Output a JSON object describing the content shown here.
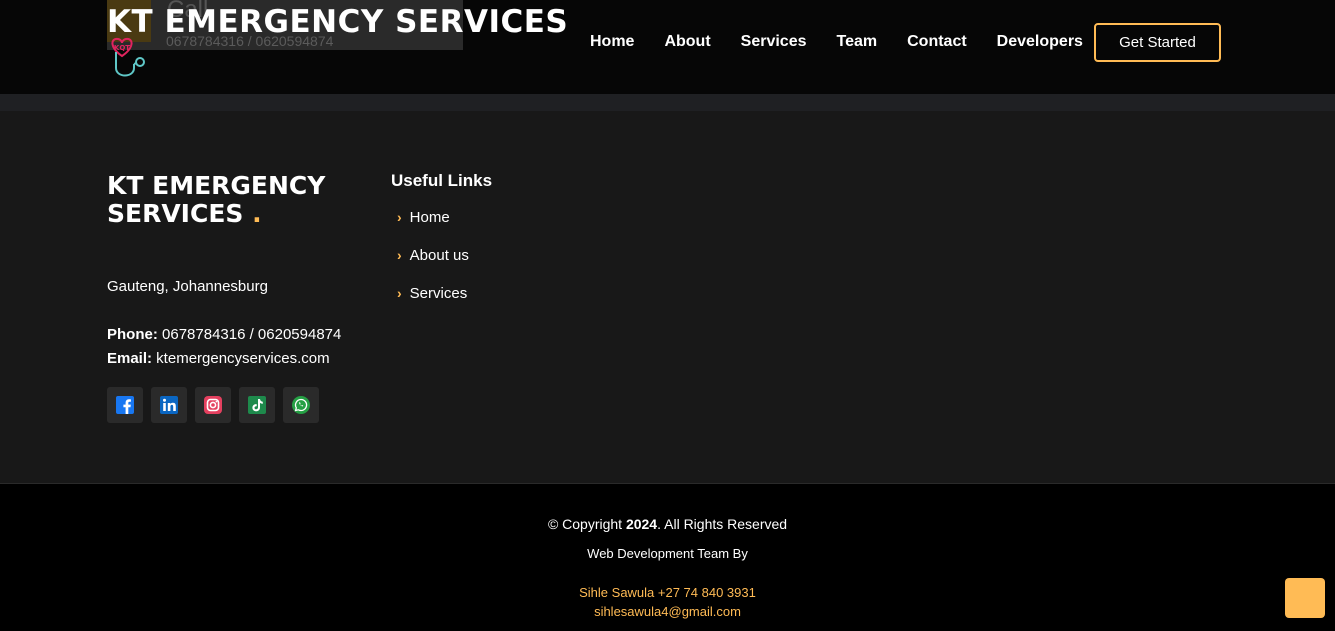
{
  "header": {
    "ghost_call_label": "Call",
    "ghost_call_phone": "0678784316 / 0620594874",
    "brand": "KT EMERGENCY SERVICES",
    "nav": [
      "Home",
      "About",
      "Services",
      "Team",
      "Contact",
      "Developers"
    ],
    "cta": "Get Started"
  },
  "footer": {
    "brand": "KT EMERGENCY SERVICES",
    "brand_dot": ".",
    "address": "Gauteng, Johannesburg",
    "phone_label": "Phone:",
    "phone": " 0678784316 / 0620594874",
    "email_label": "Email:",
    "email": " ktemergencyservices.com",
    "socials": [
      "facebook",
      "linkedin",
      "instagram",
      "tiktok",
      "whatsapp"
    ],
    "useful_links_title": "Useful Links",
    "useful_links": [
      "Home",
      "About us",
      "Services"
    ]
  },
  "bottom": {
    "copyright_prefix": "© Copyright ",
    "copyright_year": "2024",
    "copyright_suffix": ". All Rights Reserved",
    "web_dev": "Web Development Team By",
    "dev_name": "Sihle Sawula +27 74 840 3931",
    "dev_email": "sihlesawula4@gmail.com"
  },
  "colors": {
    "accent": "#ffbb55",
    "header_bg": "#060606",
    "footer_bg": "#181818",
    "bottom_bg": "#000000"
  }
}
